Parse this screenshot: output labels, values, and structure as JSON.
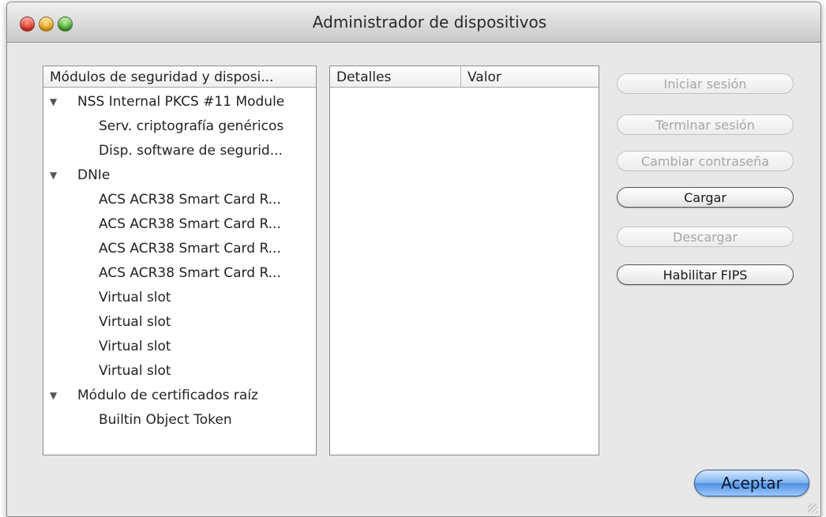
{
  "window": {
    "title": "Administrador de dispositivos"
  },
  "tree": {
    "header": "Módulos de seguridad y disposi...",
    "items": [
      {
        "label": "NSS Internal PKCS #11 Module",
        "level": 0,
        "expanded": true
      },
      {
        "label": "Serv. criptografía genéricos",
        "level": 1
      },
      {
        "label": "Disp. software de segurid...",
        "level": 1
      },
      {
        "label": "DNIe",
        "level": 0,
        "expanded": true
      },
      {
        "label": "ACS ACR38 Smart Card R...",
        "level": 1
      },
      {
        "label": "ACS ACR38 Smart Card R...",
        "level": 1
      },
      {
        "label": "ACS ACR38 Smart Card R...",
        "level": 1
      },
      {
        "label": "ACS ACR38 Smart Card R...",
        "level": 1
      },
      {
        "label": "Virtual slot",
        "level": 1
      },
      {
        "label": "Virtual slot",
        "level": 1
      },
      {
        "label": "Virtual slot",
        "level": 1
      },
      {
        "label": "Virtual slot",
        "level": 1
      },
      {
        "label": "Módulo de certificados raíz",
        "level": 0,
        "expanded": true
      },
      {
        "label": "Builtin Object Token",
        "level": 1
      }
    ]
  },
  "details": {
    "col_details": "Detalles",
    "col_value": "Valor"
  },
  "buttons": {
    "login": "Iniciar sesión",
    "logout": "Terminar sesión",
    "change_password": "Cambiar contraseña",
    "load": "Cargar",
    "unload": "Descargar",
    "enable_fips": "Habilitar FIPS",
    "ok": "Aceptar"
  }
}
